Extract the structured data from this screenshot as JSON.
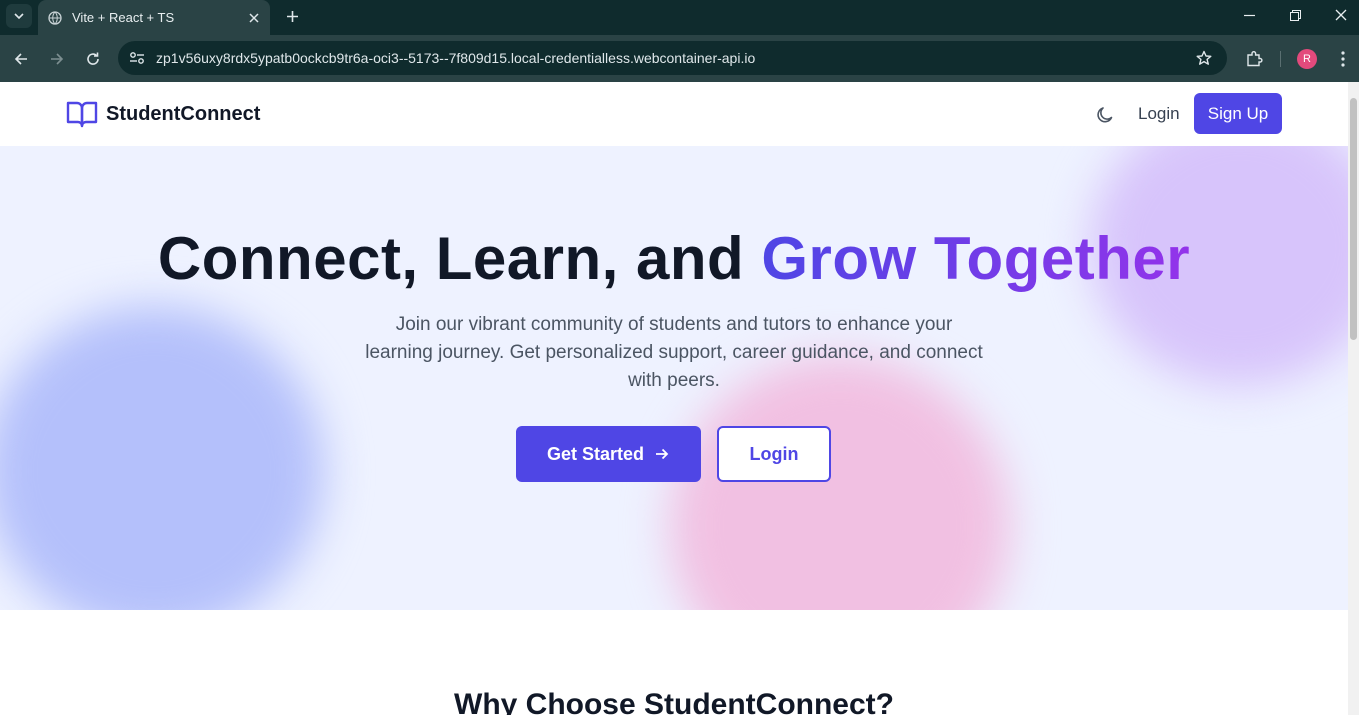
{
  "browser": {
    "tab_title": "Vite + React + TS",
    "url": "zp1v56uxy8rdx5ypatb0ockcb9tr6a-oci3--5173--7f809d15.local-credentialless.webcontainer-api.io",
    "profile_initial": "R"
  },
  "nav": {
    "brand": "StudentConnect",
    "login": "Login",
    "signup": "Sign Up"
  },
  "hero": {
    "headline_main": "Connect, Learn, and ",
    "headline_accent": "Grow Together",
    "subtext": "Join our vibrant community of students and tutors to enhance your learning journey. Get personalized support, career guidance, and connect with peers.",
    "primary_cta": "Get Started",
    "secondary_cta": "Login"
  },
  "features": {
    "title": "Why Choose StudentConnect?"
  },
  "colors": {
    "accent": "#4f46e5",
    "gradient_end": "#9333ea",
    "hero_bg": "#eef2ff"
  }
}
